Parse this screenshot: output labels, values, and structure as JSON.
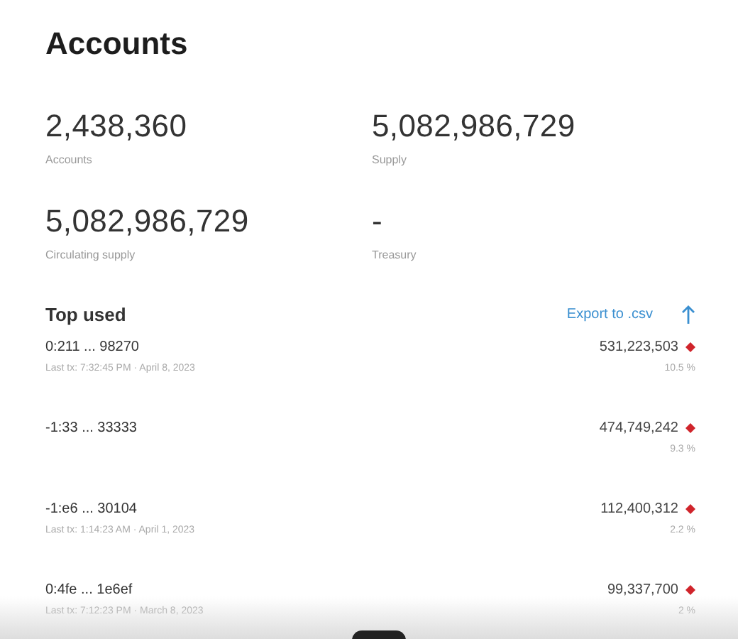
{
  "title": "Accounts",
  "stats": [
    {
      "value": "2,438,360",
      "label": "Accounts"
    },
    {
      "value": "5,082,986,729",
      "label": "Supply"
    },
    {
      "value": "5,082,986,729",
      "label": "Circulating supply"
    },
    {
      "value": "-",
      "label": "Treasury"
    }
  ],
  "top_used": {
    "heading": "Top used",
    "export": "Export to .csv",
    "rows": [
      {
        "address": "0:211 ... 98270",
        "last_tx": "Last tx: 7:32:45 PM · April 8, 2023",
        "balance": "531,223,503",
        "share": "10.5 %"
      },
      {
        "address": "-1:33 ... 33333",
        "balance": "474,749,242",
        "share": "9.3 %"
      },
      {
        "address": "-1:e6 ... 30104",
        "last_tx": "Last tx: 1:14:23 AM · April 1, 2023",
        "balance": "112,400,312",
        "share": "2.2 %"
      },
      {
        "address": "0:4fe ... 1e6ef",
        "last_tx": "Last tx: 7:12:23 PM · March 8, 2023",
        "balance": "99,337,700",
        "share": "2 %"
      }
    ]
  }
}
